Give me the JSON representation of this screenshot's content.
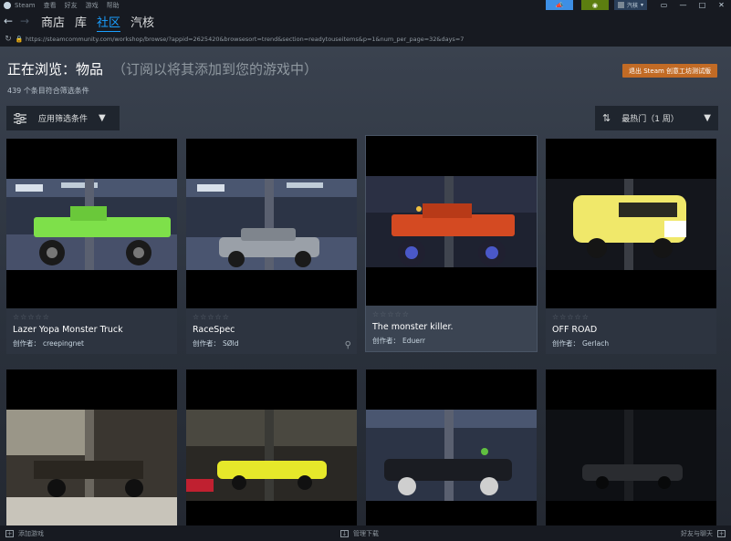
{
  "menubar": {
    "app_name": "Steam",
    "items": [
      "查看",
      "好友",
      "游戏",
      "帮助"
    ],
    "account_name": "汽核",
    "accent_announce": "#3d8fe5",
    "accent_notify": "#5c7e10"
  },
  "nav": {
    "tabs": [
      {
        "label": "商店",
        "active": false
      },
      {
        "label": "库",
        "active": false
      },
      {
        "label": "社区",
        "active": true
      },
      {
        "label": "汽核",
        "active": false
      }
    ]
  },
  "url": "https://steamcommunity.com/workshop/browse/?appid=2625420&browsesort=trend&section=readytouseitems&p=1&num_per_page=32&days=7",
  "page": {
    "title": "正在浏览：物品",
    "subtitle": "（订阅以将其添加到您的游戏中）",
    "result_count": "439 个条目符合筛选条件",
    "exit_button": "退出 Steam 创意工坊测试版",
    "filter_button": "应用筛选条件",
    "sort_button": "最热门（1 周）"
  },
  "author_label": "创作者：",
  "items": [
    {
      "name": "Lazer Yopa Monster Truck",
      "author": "creepingnet",
      "rating": 0
    },
    {
      "name": "RaceSpec",
      "author": "SØld",
      "rating": 0
    },
    {
      "name": "The monster killer.",
      "author": "Eduerr",
      "rating": 0
    },
    {
      "name": "OFF ROAD",
      "author": "Gerlach",
      "rating": 0
    },
    {
      "name": "",
      "author": ""
    },
    {
      "name": "",
      "author": ""
    },
    {
      "name": "",
      "author": ""
    },
    {
      "name": "",
      "author": ""
    }
  ],
  "statusbar": {
    "add_game": "添加游戏",
    "downloads": "管理下载",
    "friends": "好友与聊天"
  },
  "icons": [
    "steam-logo-icon",
    "megaphone-icon",
    "bell-icon",
    "back-arrow-icon",
    "forward-arrow-icon",
    "reload-icon",
    "lock-icon",
    "filter-sliders-icon",
    "chevron-down-icon",
    "sort-icon",
    "search-icon",
    "plus-icon",
    "download-icon",
    "minimize-icon",
    "maximize-icon",
    "close-icon"
  ]
}
